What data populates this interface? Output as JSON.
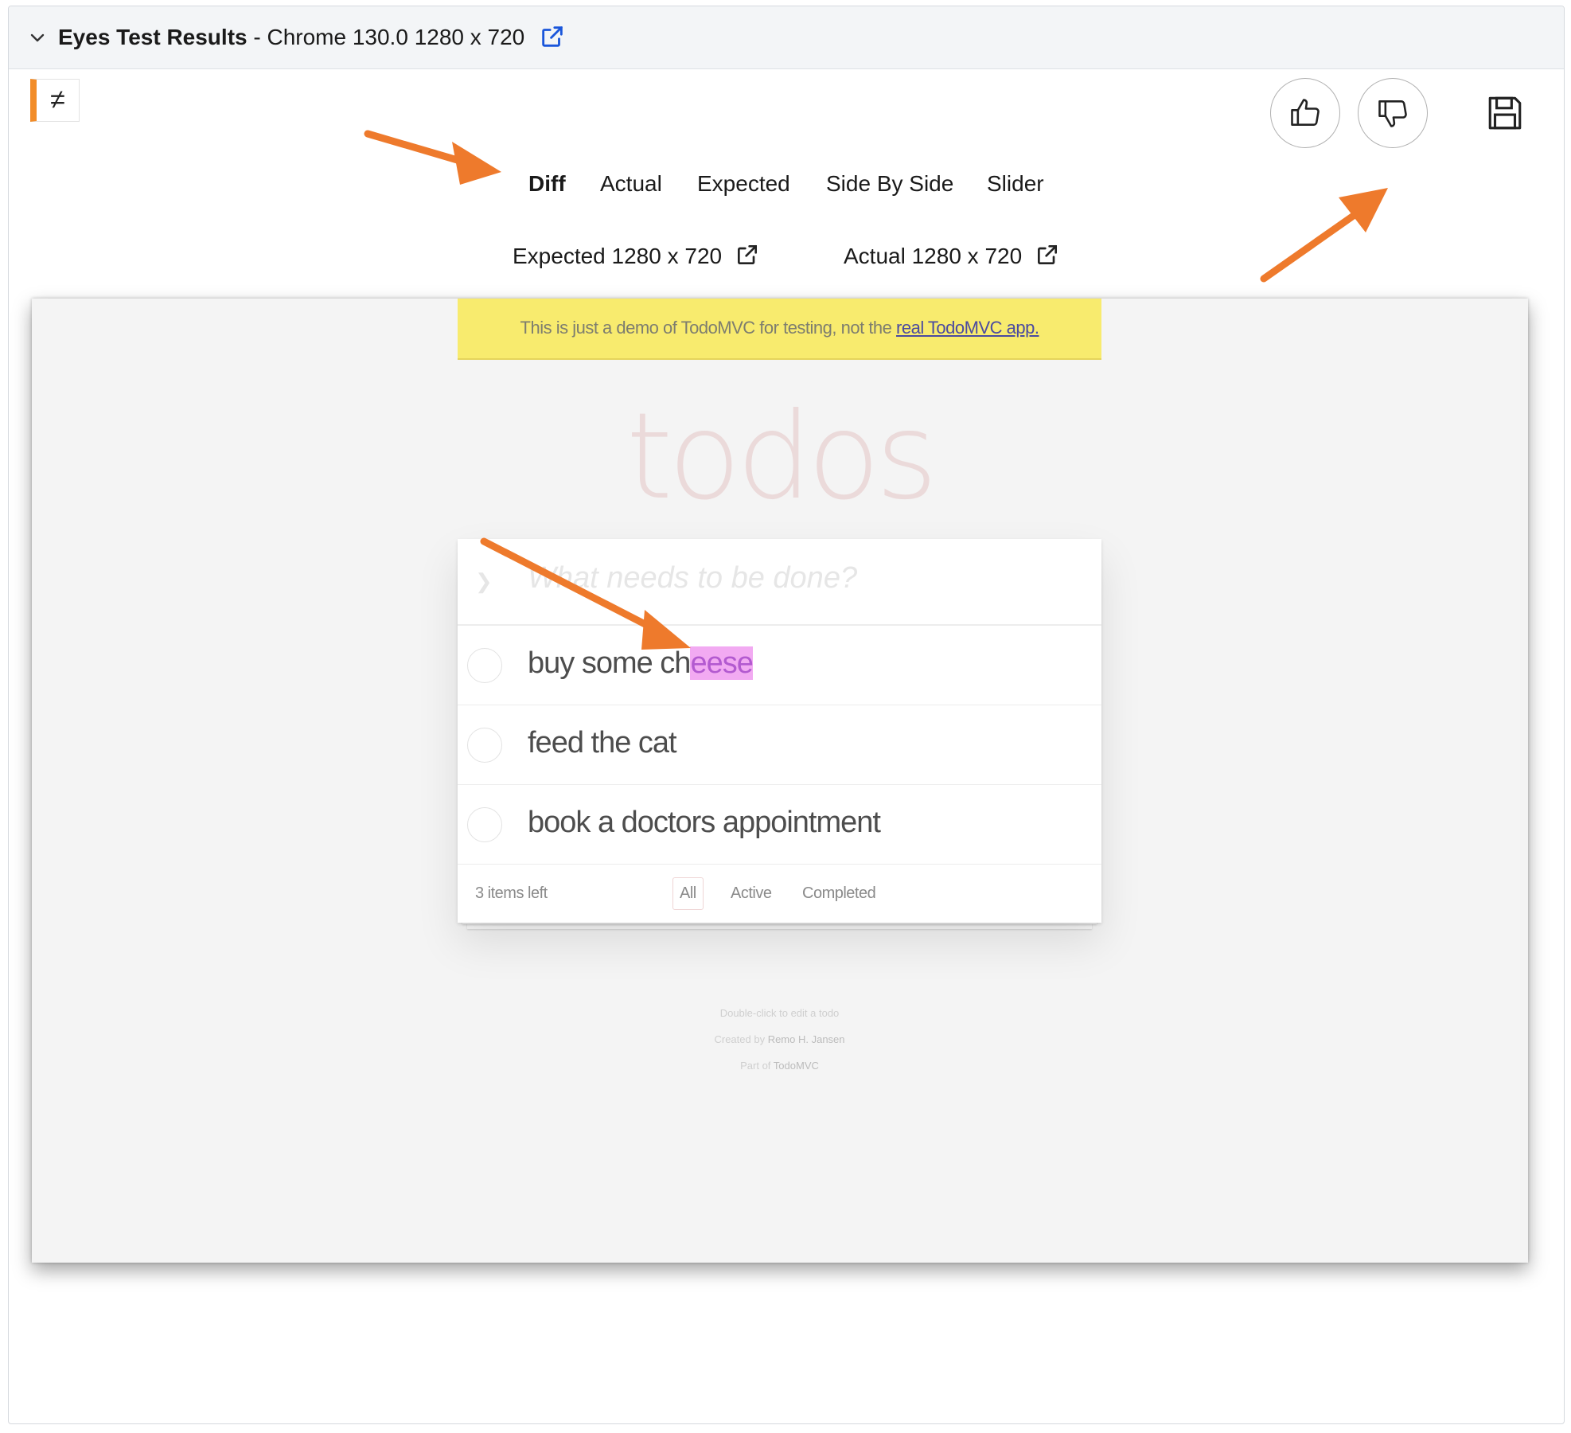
{
  "panel": {
    "title_bold": "Eyes Test Results",
    "title_rest": " - Chrome 130.0 1280 x 720",
    "status_symbol": "≠",
    "accent_color": "#f28c28"
  },
  "tabs": [
    {
      "label": "Diff",
      "active": true
    },
    {
      "label": "Actual"
    },
    {
      "label": "Expected"
    },
    {
      "label": "Side By Side"
    },
    {
      "label": "Slider"
    }
  ],
  "links": {
    "expected": "Expected 1280 x 720",
    "actual": "Actual 1280 x 720"
  },
  "screenshot": {
    "banner_text": "This is just a demo of TodoMVC for testing, not the ",
    "banner_link": "real TodoMVC app.",
    "logo": "todos",
    "placeholder": "What needs to be done?",
    "todos": [
      {
        "text_plain": "buy some ch",
        "text_diff": "eese"
      },
      {
        "text_plain": "feed the cat",
        "text_diff": ""
      },
      {
        "text_plain": "book a doctors appointment",
        "text_diff": ""
      }
    ],
    "items_left": "3 items left",
    "filters": [
      "All",
      "Active",
      "Completed"
    ],
    "info": {
      "line1": "Double-click to edit a todo",
      "line2_prefix": "Created by ",
      "line2_name": "Remo H. Jansen",
      "line3_prefix": "Part of ",
      "line3_name": "TodoMVC"
    }
  },
  "icons": {
    "collapse": "chevron-down-icon",
    "open": "external-link-icon",
    "approve": "thumbs-up-icon",
    "reject": "thumbs-down-icon",
    "save": "save-icon"
  },
  "colors": {
    "annotation_arrow": "#ee7a2c",
    "diff_highlight": "#e864e8",
    "link_blue": "#1a56db"
  }
}
